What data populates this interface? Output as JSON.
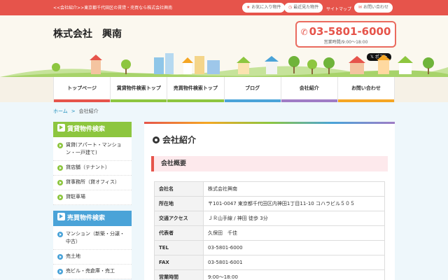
{
  "topbar": {
    "tagline": "<<会社紹介>>東京都千代田区の賃貸・売買なら株式会社興南",
    "favorites_label": "お気に入り物件",
    "recent_label": "最近見た物件",
    "sitemap_label": "サイトマップ",
    "contact_label": "お問い合わせ"
  },
  "header": {
    "company": "株式会社　興南",
    "tel": "03-5801-6000",
    "hours": "営業時間/9:00～18:00",
    "xpost": "ポスト"
  },
  "nav": [
    {
      "label": "トップページ",
      "color": "#e6544b"
    },
    {
      "label": "賃貸物件検索トップ",
      "color": "#8dc63f"
    },
    {
      "label": "売買物件検索トップ",
      "color": "#8dc63f"
    },
    {
      "label": "ブログ",
      "color": "#4aa3d8"
    },
    {
      "label": "会社紹介",
      "color": "#a07cc5"
    },
    {
      "label": "お問い合わせ",
      "color": "#f5a623"
    }
  ],
  "breadcrumb": {
    "home": "ホーム",
    "current": "会社紹介"
  },
  "sidebar": {
    "rent": {
      "title": "賃貸物件検索",
      "items": [
        "賃貸(アパート・マンション・一戸建て)",
        "貸店舗（テナント）",
        "貸事務所（貸オフィス）",
        "貸駐車場"
      ]
    },
    "sale": {
      "title": "売買物件検索",
      "items": [
        "マンション（新築・分譲・中古）",
        "売土地",
        "売ビル・売倉庫・売工"
      ]
    }
  },
  "content": {
    "title": "会社紹介",
    "section": "会社概要",
    "rows": [
      {
        "k": "会社名",
        "v": "株式会社興南"
      },
      {
        "k": "所在地",
        "v": "〒101-0047 東京都千代田区内神田1丁目11-10 コハラビル５０５"
      },
      {
        "k": "交通アクセス",
        "v": "ＪＲ山手線 / 神田 徒歩 3分"
      },
      {
        "k": "代表者",
        "v": "久保田　千佳"
      },
      {
        "k": "TEL",
        "v": "03-5801-6000"
      },
      {
        "k": "FAX",
        "v": "03-5801-6001"
      },
      {
        "k": "営業時間",
        "v": "9:00～18:00"
      }
    ]
  }
}
